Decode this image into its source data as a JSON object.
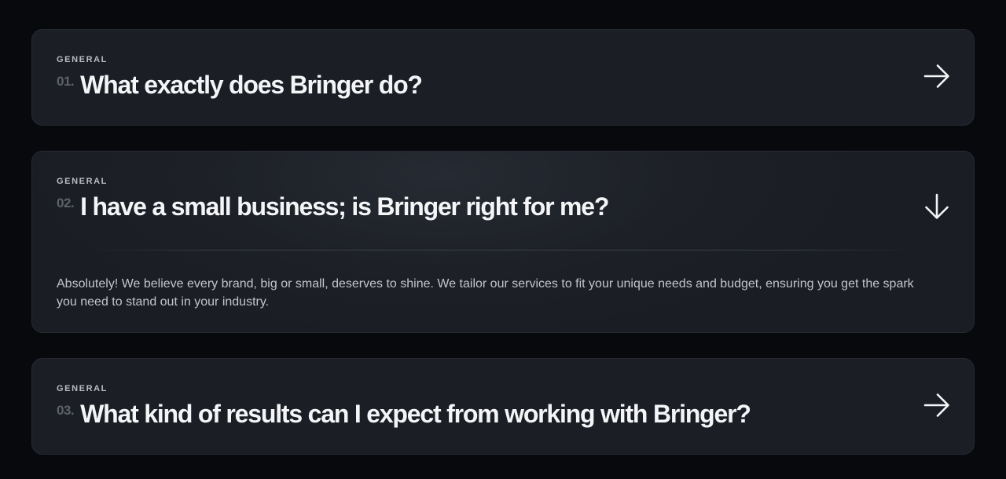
{
  "faq": {
    "items": [
      {
        "category": "GENERAL",
        "number": "01.",
        "question": "What exactly does Bringer do?",
        "state": "collapsed",
        "icon": "arrow-right-icon"
      },
      {
        "category": "GENERAL",
        "number": "02.",
        "question": "I have a small business; is Bringer right for me?",
        "state": "expanded",
        "icon": "arrow-down-icon",
        "answer": "Absolutely! We believe every brand, big or small, deserves to shine. We tailor our services to fit your unique needs and budget, ensuring you get the spark you need to stand out in your industry."
      },
      {
        "category": "GENERAL",
        "number": "03.",
        "question": "What kind of results can I expect from working with Bringer?",
        "state": "collapsed",
        "icon": "arrow-right-icon"
      }
    ]
  },
  "colors": {
    "background": "#07090d",
    "card": "#1b1e25",
    "card_border": "#262a33",
    "question": "#f4f5f7",
    "number": "#5d616b",
    "answer": "#c2c5cc"
  }
}
